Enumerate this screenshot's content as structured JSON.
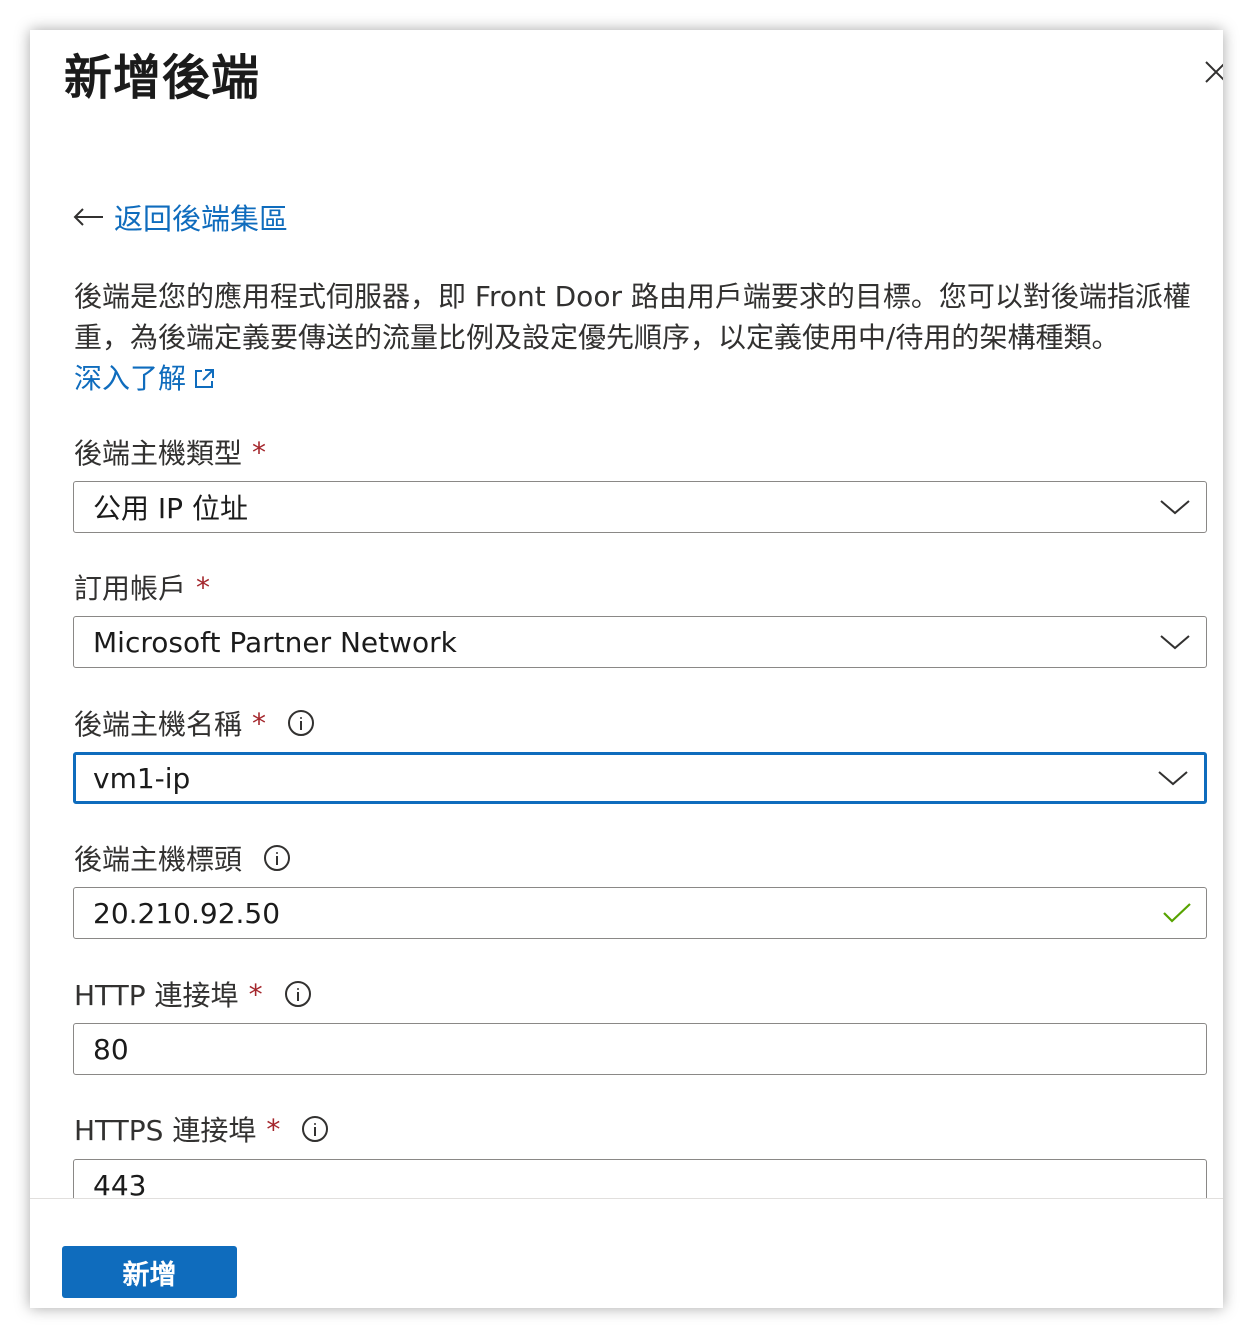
{
  "panel": {
    "title": "新增後端",
    "back_link": "返回後端集區",
    "description": "後端是您的應用程式伺服器，即 Front Door 路由用戶端要求的目標。您可以對後端指派權重，為後端定義要傳送的流量比例及設定優先順序，以定義使用中/待用的架構種類。",
    "learn_more": "深入了解"
  },
  "fields": {
    "host_type": {
      "label": "後端主機類型",
      "required_mark": "*",
      "value": "公用 IP 位址"
    },
    "subscription": {
      "label": "訂用帳戶",
      "required_mark": "*",
      "value": "Microsoft Partner Network"
    },
    "host_name": {
      "label": "後端主機名稱",
      "required_mark": "*",
      "value": "vm1-ip"
    },
    "host_header": {
      "label": "後端主機標頭",
      "value": "20.210.92.50"
    },
    "http_port": {
      "label": "HTTP 連接埠",
      "required_mark": "*",
      "value": "80"
    },
    "https_port": {
      "label": "HTTPS 連接埠",
      "required_mark": "*",
      "value": "443"
    }
  },
  "footer": {
    "add_button": "新增"
  },
  "icons": [
    "close-icon",
    "back-arrow-icon",
    "external-link-icon",
    "info-icon",
    "chevron-down-icon",
    "checkmark-icon"
  ],
  "colors": {
    "accent": "#0f6cbd",
    "required": "#a4262c",
    "valid": "#57a300"
  }
}
